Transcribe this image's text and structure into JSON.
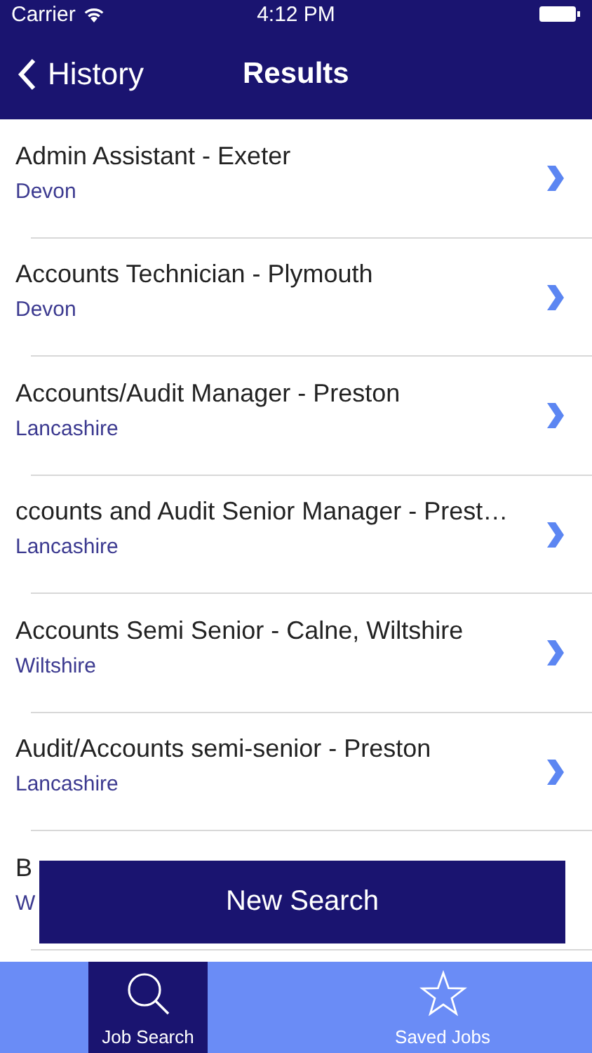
{
  "status_bar": {
    "carrier": "Carrier",
    "time": "4:12 PM"
  },
  "nav": {
    "back": "History",
    "title": "Results"
  },
  "results": [
    {
      "title": "Admin Assistant - Exeter",
      "location": "Devon"
    },
    {
      "title": "Accounts Technician - Plymouth",
      "location": "Devon"
    },
    {
      "title": "Accounts/Audit Manager - Preston",
      "location": "Lancashire"
    },
    {
      "title": "ccounts and Audit Senior Manager - Prest…",
      "location": "Lancashire"
    },
    {
      "title": "Accounts Semi Senior - Calne, Wiltshire",
      "location": "Wiltshire"
    },
    {
      "title": "Audit/Accounts semi-senior - Preston",
      "location": "Lancashire"
    },
    {
      "title": "B",
      "location": "W"
    }
  ],
  "new_search": "New Search",
  "tabs": [
    {
      "label": "Job Search",
      "kind": "search",
      "selected": true
    },
    {
      "label": "Saved Jobs",
      "kind": "favorites",
      "selected": false
    }
  ]
}
